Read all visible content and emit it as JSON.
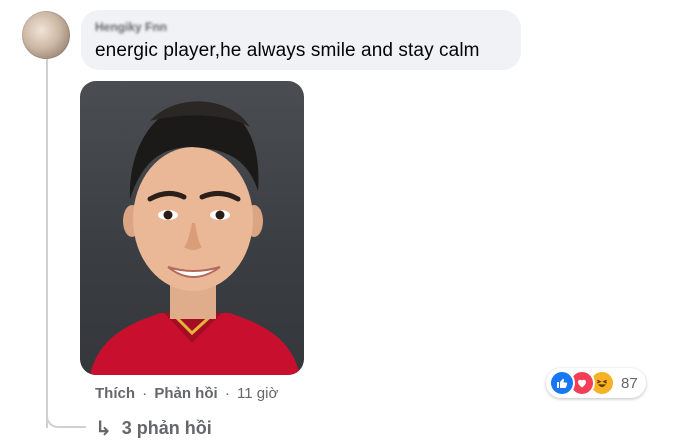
{
  "comment": {
    "author": "Hengiky Fnn",
    "text": "energic player,he always smile and stay calm",
    "image_alt": "photo"
  },
  "actions": {
    "like": "Thích",
    "reply": "Phản hồi",
    "separator": "·",
    "time": "11 giờ"
  },
  "reactions": {
    "icons": [
      "like-icon",
      "love-icon",
      "haha-icon"
    ],
    "count": "87",
    "colors": {
      "like": "#1877f2",
      "love": "#f33e58",
      "haha": "#f7b125"
    }
  },
  "replies": {
    "label": "3 phản hồi"
  }
}
